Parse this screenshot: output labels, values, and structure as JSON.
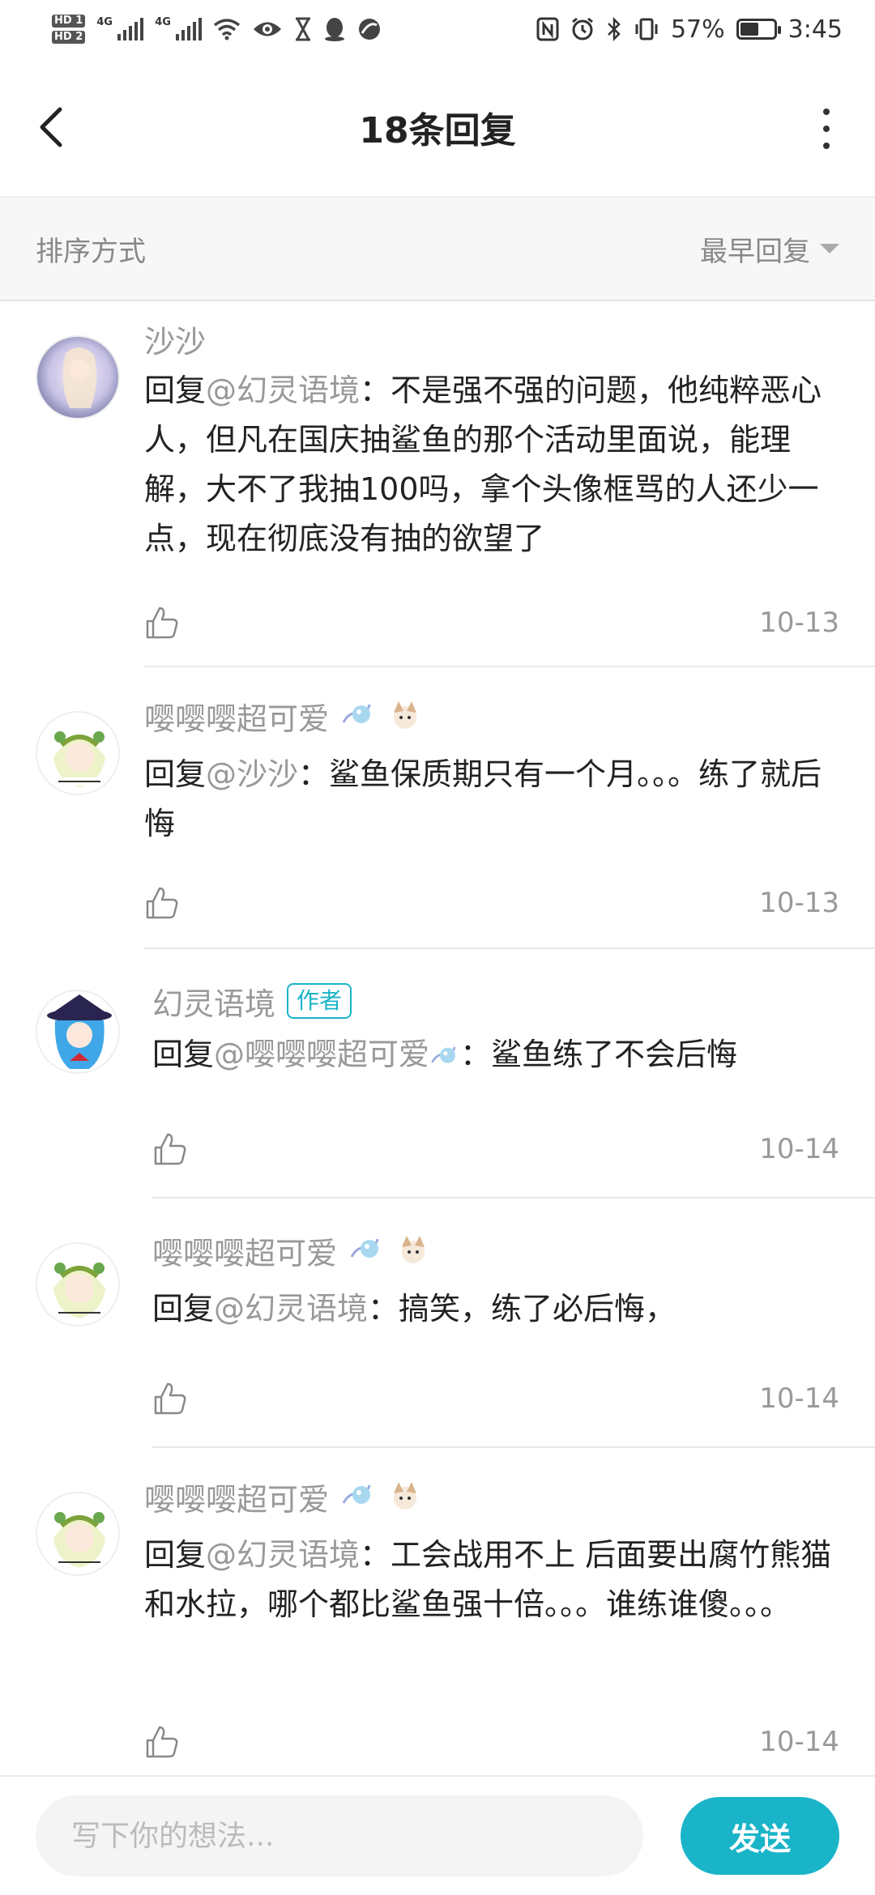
{
  "status_bar": {
    "hd1": "HD 1",
    "hd2": "HD 2",
    "net1": "4G",
    "net2": "4G",
    "battery_text": "57%",
    "battery_level": 0.57,
    "time": "3:45"
  },
  "header": {
    "title": "18条回复"
  },
  "sort": {
    "label": "排序方式",
    "value": "最早回复"
  },
  "replies": [
    {
      "username": "沙沙",
      "reply_prefix": "回复",
      "mention": "@幻灵语境",
      "text": "：不是强不强的问题，他纯粹恶心人，但凡在国庆抽鲨鱼的那个活动里面说，能理解，大不了我抽100吗，拿个头像框骂的人还少一点，现在彻底没有抽的欲望了",
      "date": "10-13"
    },
    {
      "username": "嘤嘤嘤超可爱",
      "reply_prefix": "回复",
      "mention": "@沙沙",
      "text": "：鲨鱼保质期只有一个月。。。练了就后悔",
      "date": "10-13"
    },
    {
      "username": "幻灵语境",
      "badge": "作者",
      "reply_prefix": "回复",
      "mention": "@嘤嘤嘤超可爱",
      "text": "：鲨鱼练了不会后悔",
      "date": "10-14"
    },
    {
      "username": "嘤嘤嘤超可爱",
      "reply_prefix": "回复",
      "mention": "@幻灵语境",
      "text": "：搞笑，练了必后悔，",
      "date": "10-14"
    },
    {
      "username": "嘤嘤嘤超可爱",
      "reply_prefix": "回复",
      "mention": "@幻灵语境",
      "text": "：工会战用不上 后面要出腐竹熊猫和水拉，哪个都比鲨鱼强十倍。。。谁练谁傻。。。",
      "date": "10-14"
    }
  ],
  "composer": {
    "placeholder": "写下你的想法...",
    "send_label": "发送"
  },
  "colors": {
    "accent": "#19b4c8",
    "muted_text": "#999999",
    "sort_bg": "#f7f7f7"
  }
}
